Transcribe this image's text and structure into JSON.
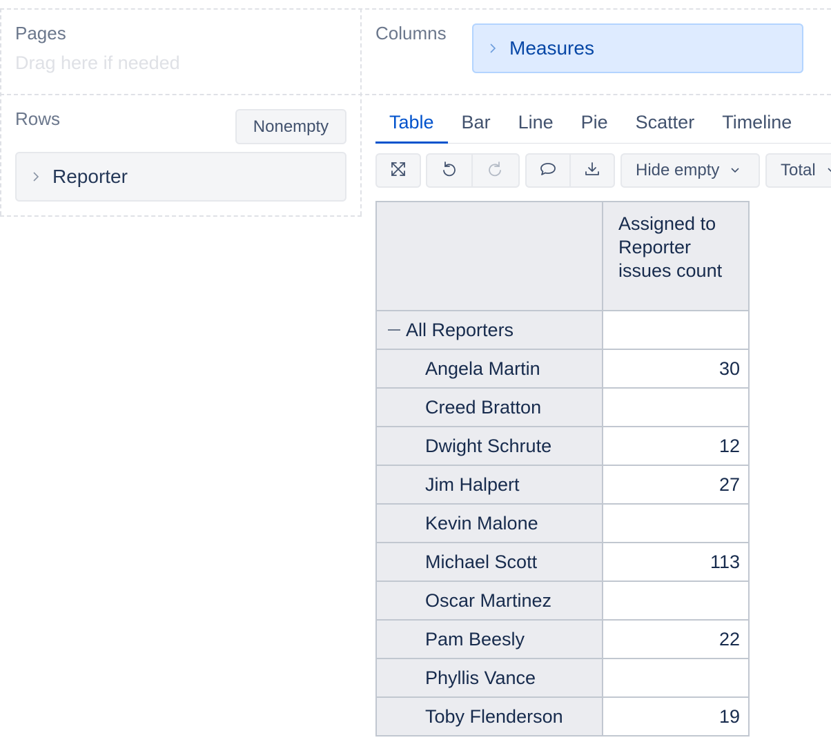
{
  "pages": {
    "label": "Pages",
    "placeholder": "Drag here if needed"
  },
  "columns": {
    "label": "Columns",
    "chip": "Measures"
  },
  "rows": {
    "label": "Rows",
    "nonempty_label": "Nonempty",
    "chip": "Reporter"
  },
  "tabs": {
    "active": "Table",
    "items": [
      "Table",
      "Bar",
      "Line",
      "Pie",
      "Scatter",
      "Timeline"
    ]
  },
  "toolbar": {
    "icons": [
      "fullscreen-icon",
      "undo-icon",
      "redo-icon",
      "comment-icon",
      "download-icon"
    ],
    "hide_empty_label": "Hide empty",
    "total_label": "Total"
  },
  "table": {
    "column_header": "Assigned to Reporter issues count",
    "rows": [
      {
        "label": "All Reporters",
        "value": "",
        "level": 0
      },
      {
        "label": "Angela Martin",
        "value": "30",
        "level": 1
      },
      {
        "label": "Creed Bratton",
        "value": "",
        "level": 1
      },
      {
        "label": "Dwight Schrute",
        "value": "12",
        "level": 1
      },
      {
        "label": "Jim Halpert",
        "value": "27",
        "level": 1
      },
      {
        "label": "Kevin Malone",
        "value": "",
        "level": 1
      },
      {
        "label": "Michael Scott",
        "value": "113",
        "level": 1
      },
      {
        "label": "Oscar Martinez",
        "value": "",
        "level": 1
      },
      {
        "label": "Pam Beesly",
        "value": "22",
        "level": 1
      },
      {
        "label": "Phyllis Vance",
        "value": "",
        "level": 1
      },
      {
        "label": "Toby Flenderson",
        "value": "19",
        "level": 1
      }
    ]
  },
  "colors": {
    "accent": "#0052cc",
    "chip_blue": "#deebff",
    "header_gray": "#ebecf0"
  }
}
